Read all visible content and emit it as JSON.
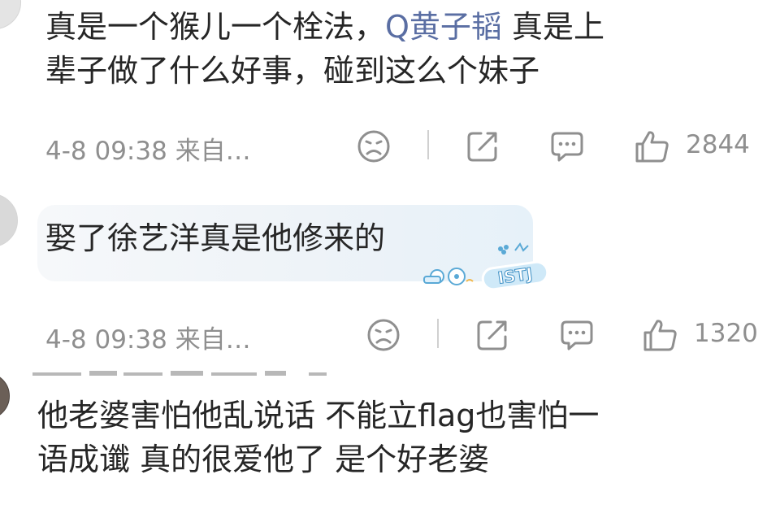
{
  "comments": [
    {
      "text_part1": "真是一个猴儿一个栓法，",
      "topic": "Q黄子韬",
      "text_part2": " 真是上",
      "text_line2": "辈子做了什么好事，碰到这么个妹子",
      "time": "4-8 09:38",
      "source": "来自…",
      "likes": "2844"
    },
    {
      "text": "娶了徐艺洋真是他修来的",
      "badge_label": "ISTJ",
      "time": "4-8 09:38",
      "source": "来自…",
      "likes": "1320"
    },
    {
      "text_line1": "他老婆害怕他乱说话 不能立flag也害怕一",
      "text_line2": "语成谶  真的很爱他了 是个好老婆"
    }
  ],
  "icons": [
    "dislike-icon",
    "share-icon",
    "comment-icon",
    "like-icon"
  ],
  "colors": {
    "topic": "#5a6ea3",
    "meta": "#8f8f8f",
    "text": "#262626",
    "bubble": "#eef3f8"
  }
}
